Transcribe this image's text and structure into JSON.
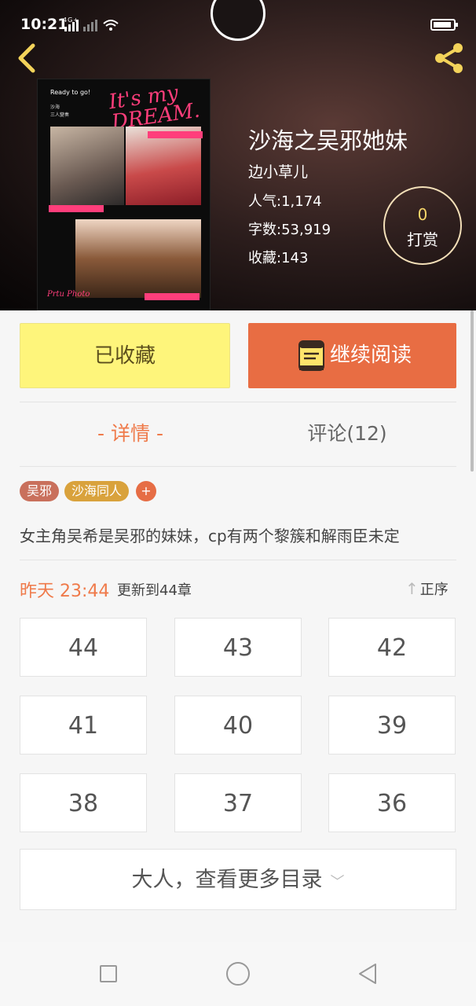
{
  "status": {
    "time": "10:21",
    "network": "4G"
  },
  "book": {
    "title": "沙海之吴邪她妹",
    "author": "边小草儿",
    "stats": [
      {
        "label": "人气:",
        "value": "1,174"
      },
      {
        "label": "字数:",
        "value": "53,919"
      },
      {
        "label": "收藏:",
        "value": "143"
      }
    ],
    "cover_text": {
      "ready": "Ready to go!",
      "line1": "沙海",
      "line2": "三人變奏",
      "script": "It's my DREAM.",
      "corner": "Prtu Photo"
    }
  },
  "tip": {
    "count": "0",
    "label": "打赏"
  },
  "actions": {
    "collected": "已收藏",
    "continue": "继续阅读"
  },
  "tabs": {
    "detail": "- 详情 -",
    "comments": "评论(12)"
  },
  "tags": [
    "吴邪",
    "沙海同人"
  ],
  "tag_add": "+",
  "description": "女主角吴希是吴邪的妹妹，cp有两个黎簇和解雨臣未定",
  "update": {
    "time": "昨天 23:44",
    "text": "更新到44章",
    "sort": "正序"
  },
  "chapters": [
    "44",
    "43",
    "42",
    "41",
    "40",
    "39",
    "38",
    "37",
    "36"
  ],
  "more": "大人，查看更多目录",
  "colors": {
    "accent": "#e86d43",
    "collected": "#fef57b",
    "tag1": "#c9705c",
    "tag2": "#d9a23c"
  }
}
